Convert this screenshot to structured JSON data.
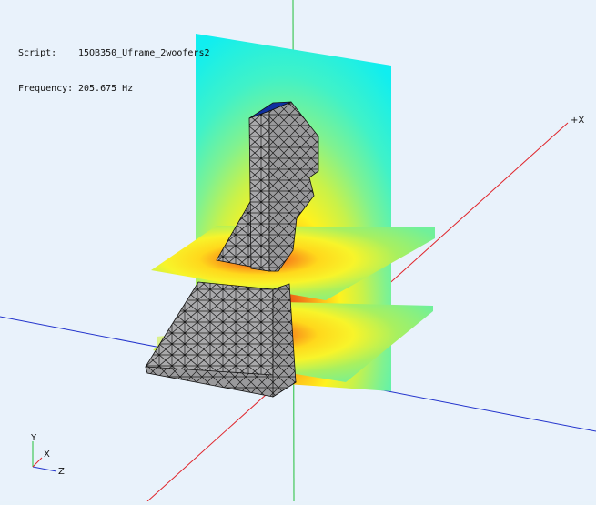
{
  "info": {
    "script_label": "Script:",
    "script_value": "15OB350_Uframe_2woofers2",
    "frequency_label": "Frequency:",
    "frequency_value": "205.675 Hz"
  },
  "axes": {
    "x_axis_label": "+X"
  },
  "orientation_gizmo": {
    "y_label": "Y",
    "x_label": "X",
    "z_label": "Z"
  },
  "colors": {
    "background": "#e9f2fb",
    "axis_x": "#e0242a",
    "axis_y": "#22c03a",
    "axis_z": "#2233cc",
    "mesh_fill": "#a8a8aa",
    "mesh_edge": "#1a1a1a"
  }
}
